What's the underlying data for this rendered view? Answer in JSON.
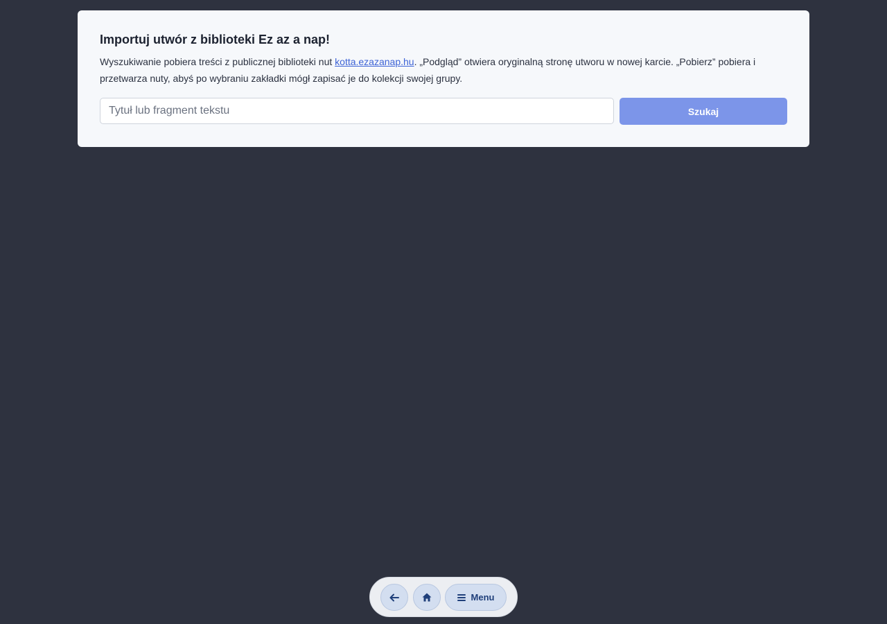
{
  "import": {
    "title": "Importuj utwór z biblioteki Ez az a nap!",
    "description_before": "Wyszukiwanie pobiera treści z publicznej biblioteki nut ",
    "link_text": "kotta.ezazanap.hu",
    "description_after": ". „Podgląd” otwiera oryginalną stronę utworu w nowej karcie. „Pobierz” pobiera i przetwarza nuty, abyś po wybraniu zakładki mógł zapisać je do kolekcji swojej grupy.",
    "search_placeholder": "Tytuł lub fragment tekstu",
    "search_value": "",
    "search_button": "Szukaj"
  },
  "bottom_nav": {
    "back_icon": "arrow-left-icon",
    "home_icon": "home-icon",
    "menu_icon": "hamburger-menu-icon",
    "menu_label": "Menu"
  },
  "colors": {
    "background": "#2e323f",
    "card": "#f6f8fb",
    "accent": "#7c95e9",
    "link": "#3d63d6"
  }
}
